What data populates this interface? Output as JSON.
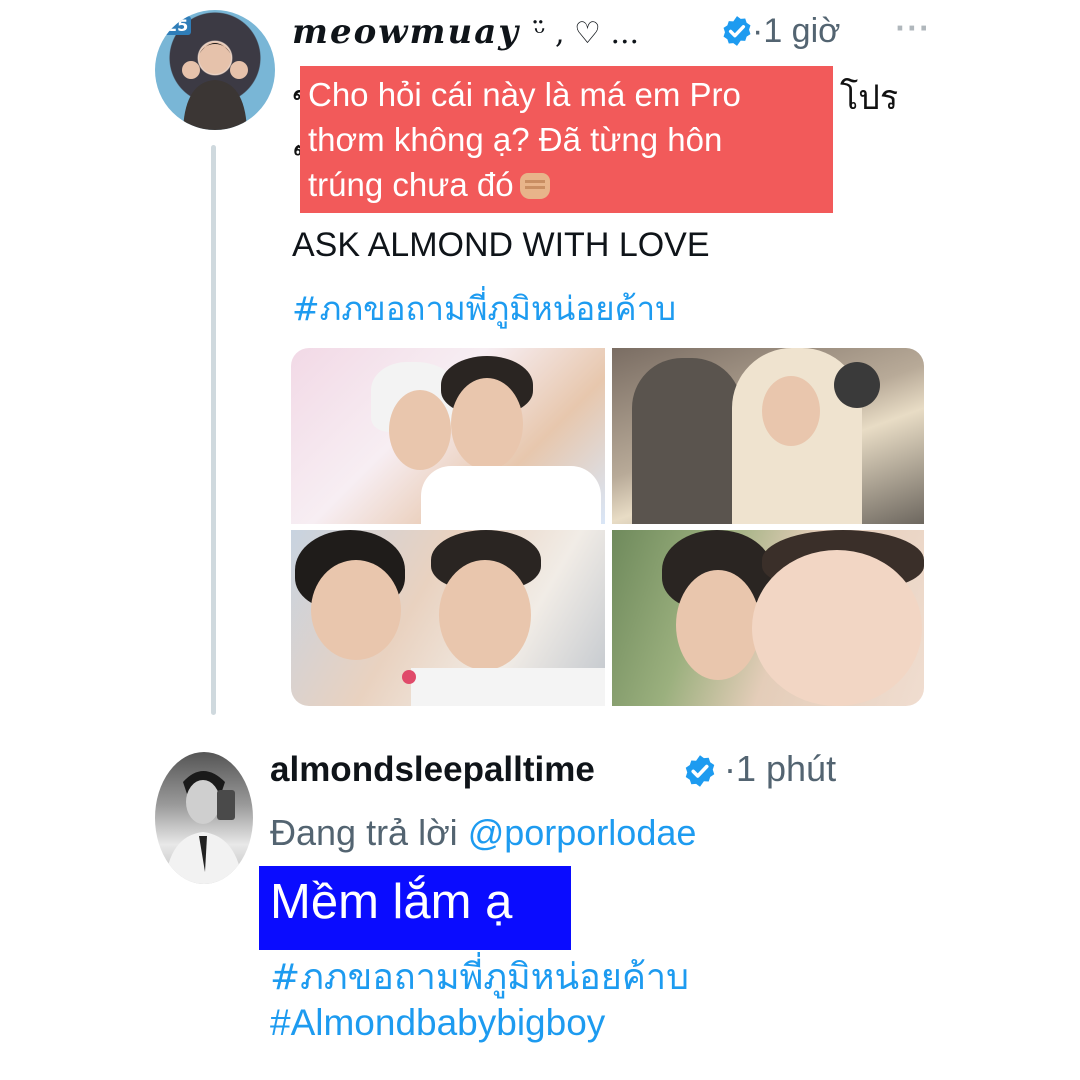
{
  "colors": {
    "accent": "#1d9bf0",
    "secondary_text": "#536471",
    "highlight_red": "#f25a5a",
    "highlight_blue": "#0a0cff",
    "thread_line": "#cfd9de"
  },
  "tweet": {
    "display_name": "meowmuay",
    "name_symbols": "ᵕ̈ , ♡ ...",
    "time": "·1 giờ",
    "more_icon": "more-dots-icon",
    "thai_fragment_1": "ข",
    "thai_fragment_2": "ๆ",
    "thai_fragment_end": "โปร",
    "question_lines": [
      "Cho hỏi cái này là má em Pro",
      "thơm không ạ? Đã từng hôn",
      "trúng chưa đó"
    ],
    "ask_line": "ASK ALMOND WITH LOVE",
    "hashtag": "#ภภขอถามพี่ภูมิหน่อยค้าบ"
  },
  "reply": {
    "display_name": "almondsleepalltime",
    "time": "·1 phút",
    "replying_prefix": "Đang trả lời",
    "replying_handle": "@porporlodae",
    "answer": "Mềm lắm ạ",
    "hashtag_1": "#ภภขอถามพี่ภูมิหน่อยค้าบ",
    "hashtag_2": "#Almondbabybigboy"
  }
}
